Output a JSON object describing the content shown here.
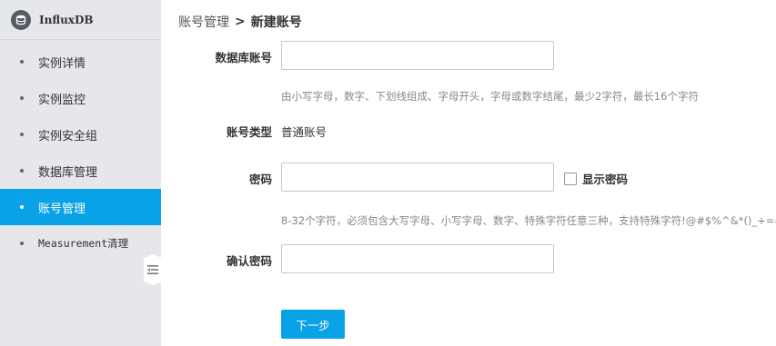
{
  "app": {
    "name": "InfluxDB",
    "logo_icon": "database-icon"
  },
  "sidebar": {
    "items": [
      {
        "label": "实例详情",
        "active": false
      },
      {
        "label": "实例监控",
        "active": false
      },
      {
        "label": "实例安全组",
        "active": false
      },
      {
        "label": "数据库管理",
        "active": false
      },
      {
        "label": "账号管理",
        "active": true
      },
      {
        "label": "Measurement清理",
        "active": false
      }
    ],
    "collapse_icon": "collapse-menu-icon"
  },
  "breadcrumb": {
    "parent": "账号管理",
    "separator": ">",
    "current": "新建账号"
  },
  "form": {
    "db_account": {
      "label": "数据库账号",
      "value": "",
      "placeholder": "",
      "hint": "由小写字母，数字、下划线组成、字母开头，字母或数字结尾，最少2字符，最长16个字符"
    },
    "account_type": {
      "label": "账号类型",
      "value": "普通账号"
    },
    "password": {
      "label": "密码",
      "value": "",
      "placeholder": "",
      "show_password_label": "显示密码",
      "show_password_checked": false,
      "hint": "8-32个字符，必须包含大写字母、小写字母、数字、特殊字符任意三种，支持特殊字符!@#$%^&*()_+=-"
    },
    "confirm_password": {
      "label": "确认密码",
      "value": "",
      "placeholder": ""
    },
    "next_button": "下一步"
  },
  "colors": {
    "accent": "#0aa2e6",
    "sidebar_bg": "#e6e7ea"
  }
}
